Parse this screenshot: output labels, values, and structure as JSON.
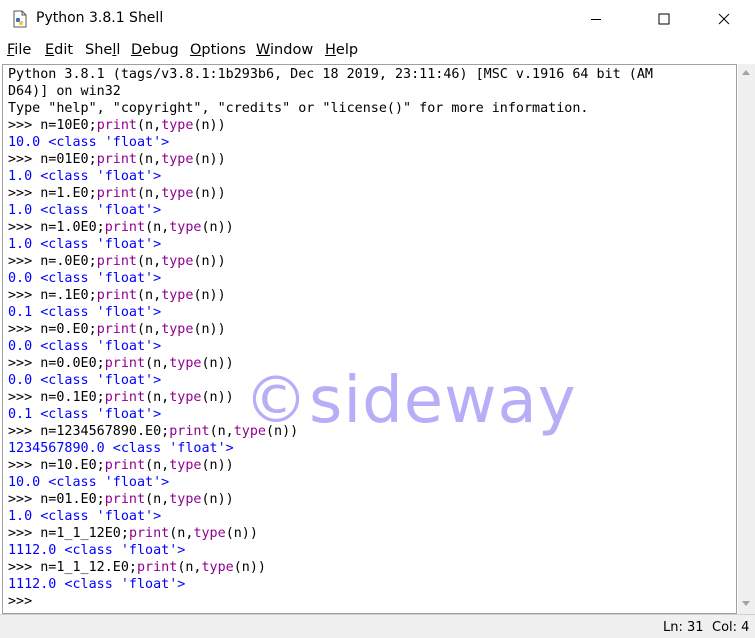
{
  "window": {
    "title": "Python 3.8.1 Shell"
  },
  "menu": [
    {
      "pre": "",
      "key": "F",
      "post": "ile"
    },
    {
      "pre": "",
      "key": "E",
      "post": "dit"
    },
    {
      "pre": "She",
      "key": "l",
      "post": "l"
    },
    {
      "pre": "",
      "key": "D",
      "post": "ebug"
    },
    {
      "pre": "",
      "key": "O",
      "post": "ptions"
    },
    {
      "pre": "",
      "key": "W",
      "post": "indow"
    },
    {
      "pre": "",
      "key": "H",
      "post": "elp"
    }
  ],
  "shell_lines": [
    {
      "kind": "plain",
      "text": "Python 3.8.1 (tags/v3.8.1:1b293b6, Dec 18 2019, 23:11:46) [MSC v.1916 64 bit (AM"
    },
    {
      "kind": "plain",
      "text": "D64)] on win32"
    },
    {
      "kind": "plain",
      "text": "Type \"help\", \"copyright\", \"credits\" or \"license()\" for more information."
    },
    {
      "kind": "input",
      "pre": ">>> n=10E0;",
      "b1": "print",
      "mid": "(n,",
      "b2": "type",
      "post": "(n))"
    },
    {
      "kind": "stdout",
      "text": "10.0 <class 'float'>"
    },
    {
      "kind": "input",
      "pre": ">>> n=01E0;",
      "b1": "print",
      "mid": "(n,",
      "b2": "type",
      "post": "(n))"
    },
    {
      "kind": "stdout",
      "text": "1.0 <class 'float'>"
    },
    {
      "kind": "input",
      "pre": ">>> n=1.E0;",
      "b1": "print",
      "mid": "(n,",
      "b2": "type",
      "post": "(n))"
    },
    {
      "kind": "stdout",
      "text": "1.0 <class 'float'>"
    },
    {
      "kind": "input",
      "pre": ">>> n=1.0E0;",
      "b1": "print",
      "mid": "(n,",
      "b2": "type",
      "post": "(n))"
    },
    {
      "kind": "stdout",
      "text": "1.0 <class 'float'>"
    },
    {
      "kind": "input",
      "pre": ">>> n=.0E0;",
      "b1": "print",
      "mid": "(n,",
      "b2": "type",
      "post": "(n))"
    },
    {
      "kind": "stdout",
      "text": "0.0 <class 'float'>"
    },
    {
      "kind": "input",
      "pre": ">>> n=.1E0;",
      "b1": "print",
      "mid": "(n,",
      "b2": "type",
      "post": "(n))"
    },
    {
      "kind": "stdout",
      "text": "0.1 <class 'float'>"
    },
    {
      "kind": "input",
      "pre": ">>> n=0.E0;",
      "b1": "print",
      "mid": "(n,",
      "b2": "type",
      "post": "(n))"
    },
    {
      "kind": "stdout",
      "text": "0.0 <class 'float'>"
    },
    {
      "kind": "input",
      "pre": ">>> n=0.0E0;",
      "b1": "print",
      "mid": "(n,",
      "b2": "type",
      "post": "(n))"
    },
    {
      "kind": "stdout",
      "text": "0.0 <class 'float'>"
    },
    {
      "kind": "input",
      "pre": ">>> n=0.1E0;",
      "b1": "print",
      "mid": "(n,",
      "b2": "type",
      "post": "(n))"
    },
    {
      "kind": "stdout",
      "text": "0.1 <class 'float'>"
    },
    {
      "kind": "input",
      "pre": ">>> n=1234567890.E0;",
      "b1": "print",
      "mid": "(n,",
      "b2": "type",
      "post": "(n))"
    },
    {
      "kind": "stdout",
      "text": "1234567890.0 <class 'float'>"
    },
    {
      "kind": "input",
      "pre": ">>> n=10.E0;",
      "b1": "print",
      "mid": "(n,",
      "b2": "type",
      "post": "(n))"
    },
    {
      "kind": "stdout",
      "text": "10.0 <class 'float'>"
    },
    {
      "kind": "input",
      "pre": ">>> n=01.E0;",
      "b1": "print",
      "mid": "(n,",
      "b2": "type",
      "post": "(n))"
    },
    {
      "kind": "stdout",
      "text": "1.0 <class 'float'>"
    },
    {
      "kind": "input",
      "pre": ">>> n=1_1_12E0;",
      "b1": "print",
      "mid": "(n,",
      "b2": "type",
      "post": "(n))"
    },
    {
      "kind": "stdout",
      "text": "1112.0 <class 'float'>"
    },
    {
      "kind": "input",
      "pre": ">>> n=1_1_12.E0;",
      "b1": "print",
      "mid": "(n,",
      "b2": "type",
      "post": "(n))"
    },
    {
      "kind": "stdout",
      "text": "1112.0 <class 'float'>"
    },
    {
      "kind": "plain",
      "text": ">>> "
    }
  ],
  "watermark": "©sideway",
  "status": {
    "ln": "Ln: 31",
    "col": "Col: 4"
  },
  "colors": {
    "stdout": "#0000ff",
    "builtin": "#900090",
    "plain": "#000000"
  }
}
